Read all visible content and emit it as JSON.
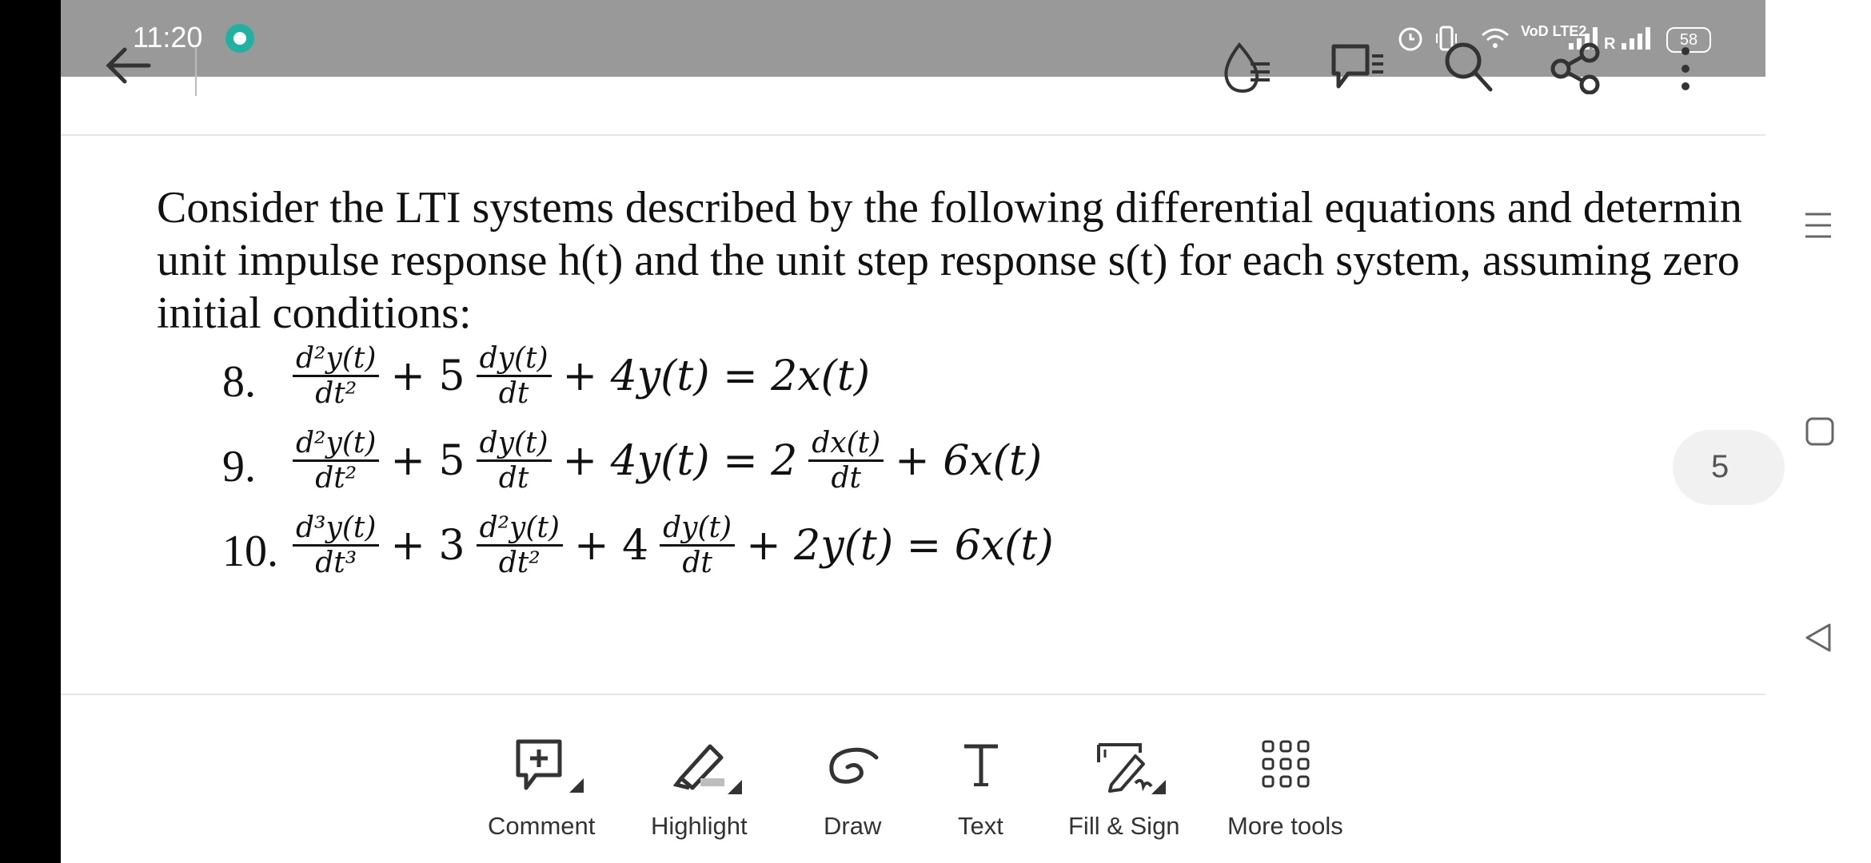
{
  "status": {
    "time": "11:20",
    "battery": "58",
    "network_label": "VoD LTE2",
    "roaming": "R"
  },
  "document": {
    "paragraph_lines": [
      "Consider the LTI systems described by the following differential equations and determin",
      "unit impulse response h(t) and the unit step response s(t) for each system, assuming zero",
      "initial conditions:"
    ],
    "equations": [
      {
        "number": "8.",
        "lhs": [
          "d²y(t)|dt²",
          "+ 5",
          "dy(t)|dt",
          "+ 4y(t) = 2x(t)"
        ]
      },
      {
        "number": "9.",
        "lhs": [
          "d²y(t)|dt²",
          "+ 5",
          "dy(t)|dt",
          "+ 4y(t) = 2",
          "dx(t)|dt",
          "+ 6x(t)"
        ]
      },
      {
        "number": "10.",
        "lhs": [
          "d³y(t)|dt³",
          "+ 3",
          "d²y(t)|dt²",
          "+ 4",
          "dy(t)|dt",
          "+ 2y(t) = 6x(t)"
        ]
      }
    ],
    "page_number": "5"
  },
  "toolbar": {
    "comment": "Comment",
    "highlight": "Highlight",
    "draw": "Draw",
    "text": "Text",
    "fill_sign": "Fill & Sign",
    "more_tools": "More tools"
  },
  "colors": {
    "status_bar": "#999999",
    "accent": "#20b2a0"
  }
}
